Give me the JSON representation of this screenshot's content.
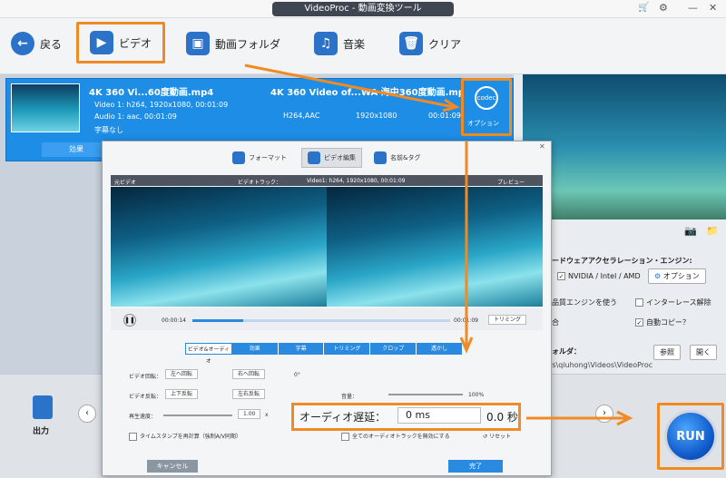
{
  "app": {
    "title": "VideoProc - 動画変換ツール"
  },
  "toolbar": {
    "back": "戻る",
    "video": "ビデオ",
    "video_folder": "動画フォルダ",
    "music": "音楽",
    "clear": "クリア"
  },
  "file": {
    "source_title": "4K 360 Vi...60度動画.mp4",
    "output_title": "4K 360 Video of...WA 海中360度動画.mp4",
    "video_info": "Video 1: h264, 1920x1080, 00:01:09",
    "audio_info": "Audio 1: aac, 00:01:09",
    "subtitle": "字幕なし",
    "codec": "H264,AAC",
    "resolution": "1920x1080",
    "duration": "00:01:09",
    "codec_badge": "codec",
    "option_label": "オプション",
    "effect": "効果"
  },
  "settings": {
    "hw_title": "ハードウェアアクセラレーション・エンジン:",
    "hw_nvidia": "NVIDIA / Intel / AMD",
    "hw_option": "オプション",
    "hq_engine": "高品質エンジンを使う",
    "deinterlace": "インターレース解除",
    "merge": "結合",
    "auto_copy": "自動コピー？",
    "output_folder_label": "フォルダ：",
    "browse": "参照",
    "open": "開く",
    "output_path": "sers\\qiuhong\\Videos\\VideoProc"
  },
  "bottom": {
    "output_label": "出力",
    "run": "RUN"
  },
  "dialog": {
    "tabs": [
      "フォーマット",
      "ビデオ編集",
      "名前&タグ"
    ],
    "source_label": "元ビデオ",
    "track_label": "ビデオトラック：",
    "track_value": "Video1: h264, 1920x1080, 00:01:09",
    "preview_label": "プレビュー",
    "time_start": "00:00:14",
    "time_end": "00:01:09",
    "trim": "トリミング",
    "subtabs": [
      "ビデオ&オーディオ",
      "効果",
      "字幕",
      "トリミング",
      "クロップ",
      "透かし"
    ],
    "rotate_label": "ビデオ回転：",
    "rotate_left": "左へ回転",
    "rotate_right": "右へ回転",
    "rotate_angle": "0°",
    "flip_label": "ビデオ反転：",
    "flip_vertical": "上下反転",
    "flip_horizontal": "左右反転",
    "speed_label": "再生速度：",
    "speed_value": "1.00",
    "speed_unit": "x",
    "volume_label": "音量：",
    "volume_value": "100%",
    "audio_delay_label": "オーディオ遅延：",
    "audio_delay_ms": "0 ms",
    "audio_delay_sec": "0.0 秒",
    "timestamp_check": "タイムスタンプを再計算（強制A/V同期）",
    "disable_audio_check": "全てのオーディオトラックを無効にする",
    "reset": "リセット",
    "cancel": "キャンセル",
    "done": "完了"
  },
  "colors": {
    "accent": "#f08a24",
    "brand": "#2a73c9",
    "card": "#1d8de6"
  }
}
